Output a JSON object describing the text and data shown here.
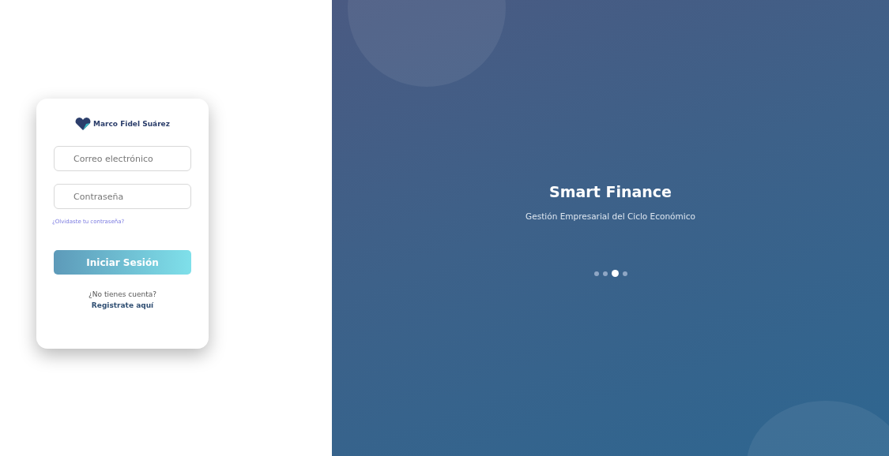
{
  "login": {
    "logo_text": "Marco Fidel Suárez",
    "email_field": {
      "placeholder": "Correo electrónico"
    },
    "password_field": {
      "placeholder": "Contraseña"
    },
    "forgot_link": "¿Olvidaste tu contraseña?",
    "submit_button": "Iniciar Sesión",
    "signup_prompt": "¿No tienes cuenta?",
    "signup_link": "Registrate aquí"
  },
  "hero": {
    "title": "Smart Finance",
    "subtitle": "Gestión Empresarial del Ciclo Económico",
    "slides": [
      {
        "selected": false
      },
      {
        "selected": false
      },
      {
        "selected": true
      },
      {
        "selected": false
      }
    ]
  }
}
